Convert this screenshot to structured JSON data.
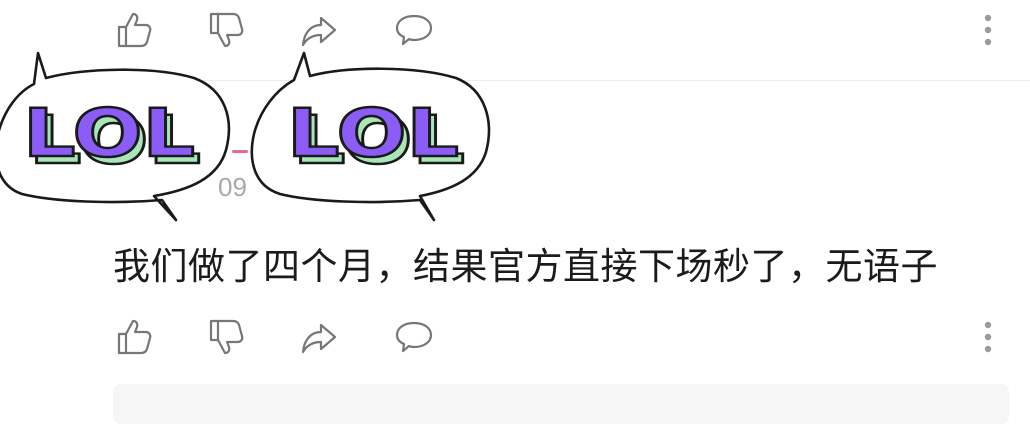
{
  "previous_actions": {
    "like_icon": "thumb-up",
    "dislike_icon": "thumb-down",
    "share_icon": "share-arrow",
    "comment_icon": "speech-bubble",
    "more_icon": "vertical-dots"
  },
  "sticker_1": {
    "text": "LOL"
  },
  "sticker_2": {
    "text": "LOL"
  },
  "comment": {
    "timestamp_fragment": "09",
    "text": "我们做了四个月，结果官方直接下场秒了，无语子"
  },
  "colors": {
    "sticker_purple": "#8b5cf6",
    "sticker_green": "#a8e6b8",
    "icon_gray": "#777777",
    "accent_pink": "#e86a92"
  }
}
